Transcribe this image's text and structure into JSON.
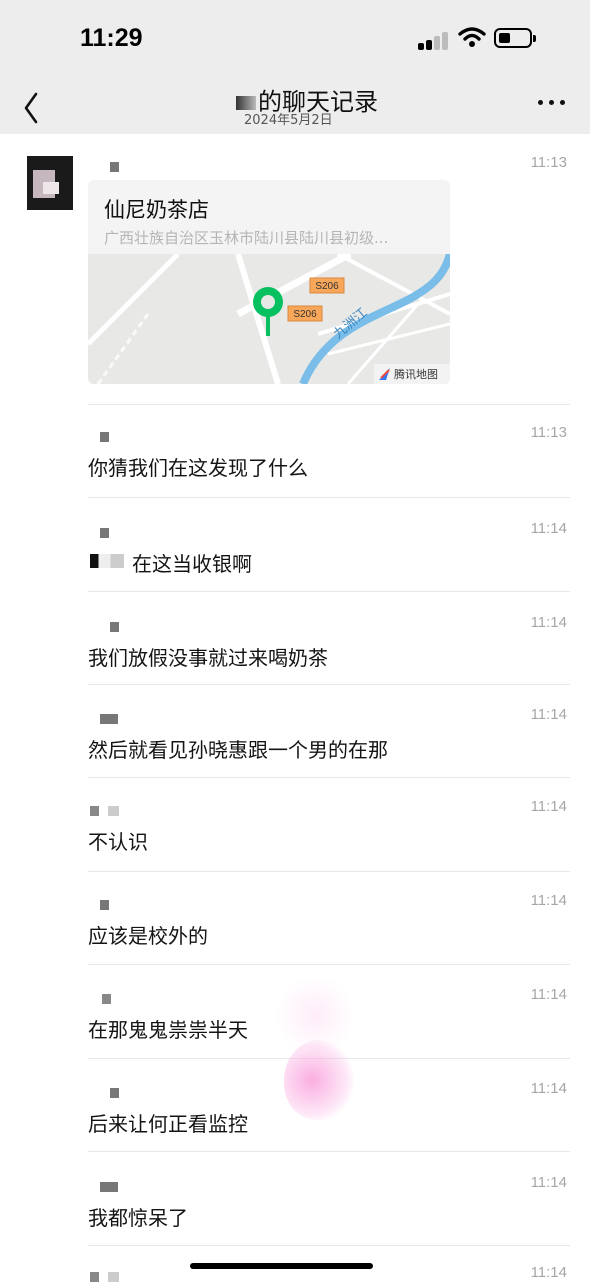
{
  "status_bar": {
    "time": "11:29"
  },
  "nav": {
    "title": "的聊天记录",
    "date": "2024年5月2日"
  },
  "location": {
    "name": "仙尼奶茶店",
    "address": "广西壮族自治区玉林市陆川县陆川县初级...",
    "map_labels": {
      "road1": "S206",
      "road2": "S206",
      "river": "九洲江",
      "provider": "腾讯地图"
    }
  },
  "messages": [
    {
      "time": "11:13",
      "text": ""
    },
    {
      "time": "11:13",
      "text": "你猜我们在这发现了什么"
    },
    {
      "time": "11:14",
      "text": "在这当收银啊"
    },
    {
      "time": "11:14",
      "text": "我们放假没事就过来喝奶茶"
    },
    {
      "time": "11:14",
      "text": "然后就看见孙晓惠跟一个男的在那"
    },
    {
      "time": "11:14",
      "text": "不认识"
    },
    {
      "time": "11:14",
      "text": "应该是校外的"
    },
    {
      "time": "11:14",
      "text": "在那鬼鬼祟祟半天"
    },
    {
      "time": "11:14",
      "text": "后来让何正看监控"
    },
    {
      "time": "11:14",
      "text": "我都惊呆了"
    },
    {
      "time": "11:14",
      "text": ""
    }
  ],
  "colors": {
    "header_bg": "#ededed",
    "pin": "#07c160",
    "river": "#6bb6e6",
    "road_label": "#f7a65a",
    "time_gray": "#a6a6a6"
  }
}
